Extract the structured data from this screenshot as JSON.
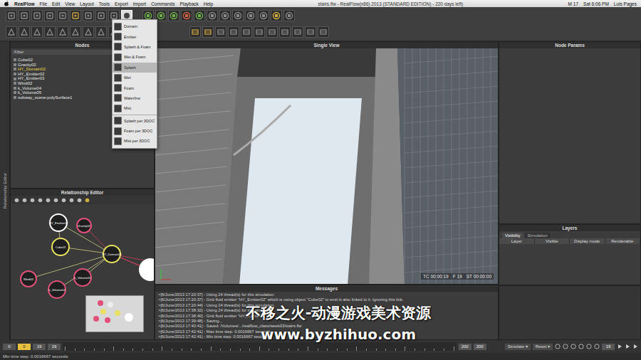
{
  "menubar": {
    "app": "RealFlow",
    "items": [
      "File",
      "Edit",
      "View",
      "Layout",
      "Tools",
      "Export",
      "Import",
      "Commands",
      "Playback",
      "Help"
    ],
    "title": "stairs.flw - RealFlow(x86) 2013 (STANDARD EDITION) - 220 days left)",
    "status": [
      "M 17",
      "Sat 6:06 PM",
      "Luis Pages"
    ]
  },
  "dropdown": [
    {
      "label": "Domain",
      "selected": false
    },
    {
      "label": "Emitter",
      "selected": false
    },
    {
      "label": "Splash & Foam",
      "selected": false
    },
    {
      "label": "Wet & Foam",
      "selected": false
    },
    {
      "label": "Splash",
      "selected": true
    },
    {
      "label": "Wet",
      "selected": false
    },
    {
      "label": "Foam",
      "selected": false
    },
    {
      "label": "Waterline",
      "selected": false
    },
    {
      "label": "Mist",
      "selected": false
    },
    {
      "label": "Splash per 3DOC",
      "selected": false
    },
    {
      "label": "Foam per 3DOC",
      "selected": false
    },
    {
      "label": "Mist per 3DOC",
      "selected": false
    }
  ],
  "nodes_panel": {
    "title": "Nodes",
    "filter": "Filter",
    "items": [
      {
        "label": "Cube02",
        "selected": false
      },
      {
        "label": "Gravity02",
        "selected": false
      },
      {
        "label": "HY_Domain02",
        "selected": true
      },
      {
        "label": "HY_Emitter02",
        "selected": false
      },
      {
        "label": "HY_Emitter03",
        "selected": false
      },
      {
        "label": "Wind02",
        "selected": false
      },
      {
        "label": "k_Volume04",
        "selected": false
      },
      {
        "label": "k_Volume05",
        "selected": false
      },
      {
        "label": "subway_scene:polySurface1",
        "selected": false
      }
    ]
  },
  "side_strip": "Relationship Editor",
  "relationship_editor": {
    "title": "Relationship Editor",
    "nodes": [
      {
        "label": "HY_Emitter02",
        "color": "#ffffff"
      },
      {
        "label": "Gravity02",
        "color": "#e0507a"
      },
      {
        "label": "Cube02",
        "color": "#e8e060"
      },
      {
        "label": "HY_Domain02",
        "color": "#e8e060"
      },
      {
        "label": "Wind02",
        "color": "#e0507a"
      },
      {
        "label": "k_Volume04",
        "color": "#e0507a"
      },
      {
        "label": "k_Volume05",
        "color": "#e0507a"
      },
      {
        "label": "",
        "color": "#ffffff"
      }
    ]
  },
  "viewport": {
    "title": "Single View",
    "overlay": [
      "TC 00:00:19",
      "F 19",
      "ST 00:00:00"
    ]
  },
  "node_params": {
    "title": "Node Params"
  },
  "layers": {
    "title": "Layers",
    "tabs": [
      {
        "label": "Visibility",
        "selected": true
      },
      {
        "label": "Simulation",
        "selected": false
      }
    ],
    "columns": [
      "Layer",
      "Visible",
      "Display mode",
      "Renderable"
    ]
  },
  "messages": {
    "title": "Messages",
    "lines": [
      ">[6/June/2013 17:20:37] - Using 24 thread(s) for this simulation.",
      ">[6/June/2013 17:20:37] - Grid fluid emitter \"HY_Emitter02\" which is using object \"Cube02\" to emit is also linked to it. Ignoring this link.",
      ">[6/June/2013 17:20:44] - Using 24 thread(s) for this simulation.",
      ">[6/June/2013 17:38:32] - Using 24 thread(s) for this simulation.",
      ">[6/June/2013 17:38:40] - Grid fluid emitter \"HY_Emitter02\"",
      ">[6/June/2013 17:39:48] - Saving...",
      ">[6/June/2013 17:40:41] - Saved: /Volumes/.../realflow_class/week03/stairs.flw",
      ">[6/June/2013 17:42:41] - Max time step: 0.0016667 seconds",
      ">[6/June/2013 17:42:41] - Min time step: 0.0016667 seconds"
    ]
  },
  "timeline": {
    "fields": [
      {
        "value": "0",
        "selected": false
      },
      {
        "value": "0",
        "selected": true
      },
      {
        "value": "19",
        "selected": false
      },
      {
        "value": "19",
        "selected": false
      }
    ],
    "end_fields": [
      "200",
      "200"
    ],
    "simulate": "Simulate",
    "reset": "Reset",
    "frame": "19"
  },
  "status_bar": "Min time step: 0.0016667 seconds",
  "watermark": {
    "line1": "不移之火-动漫游戏美术资源",
    "line2": "www.byzhihuo.com"
  }
}
